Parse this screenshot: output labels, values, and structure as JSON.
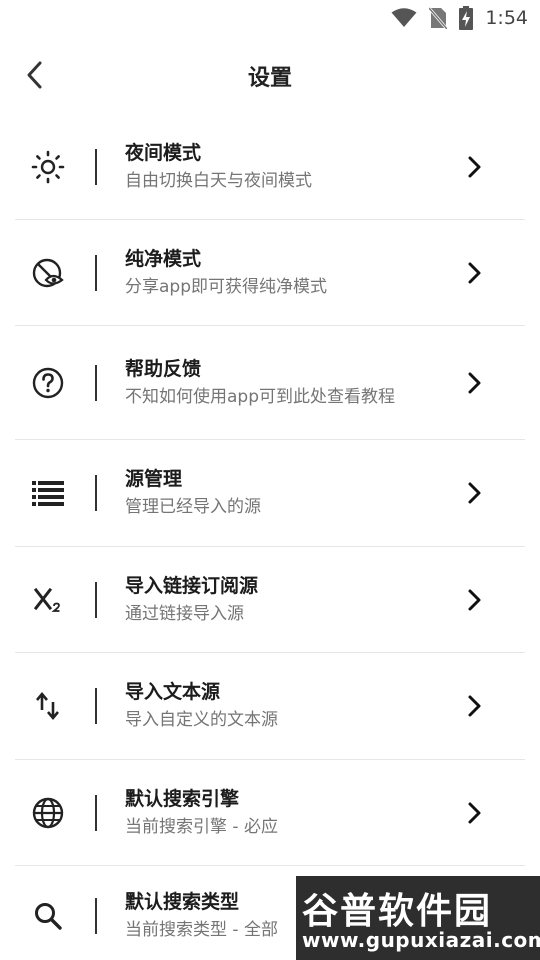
{
  "status_bar": {
    "time": "1:54"
  },
  "header": {
    "title": "设置"
  },
  "settings": [
    {
      "title": "夜间模式",
      "subtitle": "自由切换白天与夜间模式",
      "icon": "brightness-icon"
    },
    {
      "title": "纯净模式",
      "subtitle": "分享app即可获得纯净模式",
      "icon": "eye-off-icon"
    },
    {
      "title": "帮助反馈",
      "subtitle": "不知如何使用app可到此处查看教程",
      "icon": "help-icon"
    },
    {
      "title": "源管理",
      "subtitle": "管理已经导入的源",
      "icon": "list-icon"
    },
    {
      "title": "导入链接订阅源",
      "subtitle": "通过链接导入源",
      "icon": "subscript-icon"
    },
    {
      "title": "导入文本源",
      "subtitle": "导入自定义的文本源",
      "icon": "swap-vertical-icon"
    },
    {
      "title": "默认搜索引擎",
      "subtitle": "当前搜索引擎 - 必应",
      "icon": "globe-icon"
    },
    {
      "title": "默认搜索类型",
      "subtitle": "当前搜索类型 - 全部",
      "icon": "search-icon"
    }
  ],
  "watermark": {
    "text": "谷普软件园",
    "url": "www.gupuxiazai.com"
  }
}
